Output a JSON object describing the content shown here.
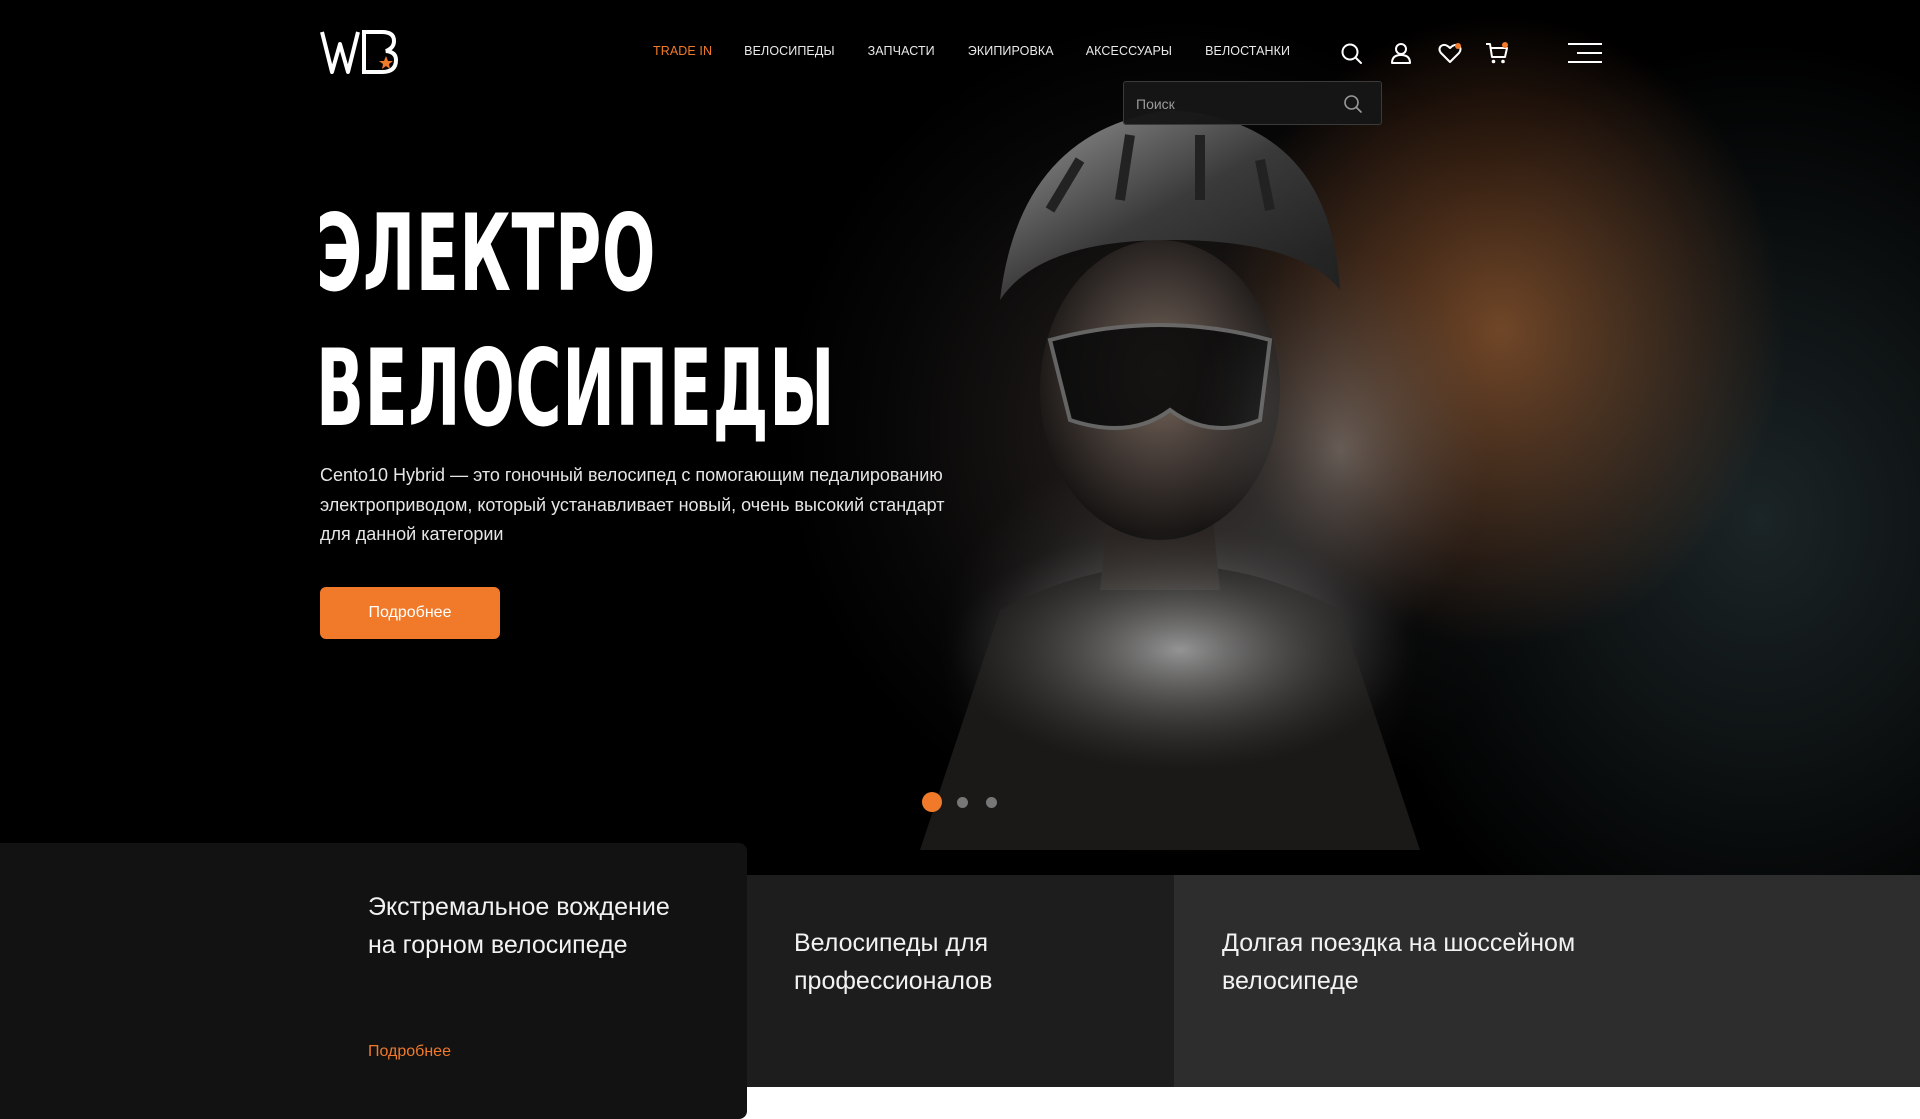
{
  "header": {
    "logo_text": "WB",
    "nav": [
      {
        "label": "TRADE IN"
      },
      {
        "label": "ВЕЛОСИПЕДЫ"
      },
      {
        "label": "ЗАПЧАСТИ"
      },
      {
        "label": "ЭКИПИРОВКА"
      },
      {
        "label": "АКСЕССУАРЫ"
      },
      {
        "label": "ВЕЛОСТАНКИ"
      }
    ],
    "icons": [
      "search-icon",
      "user-icon",
      "heart-icon",
      "cart-icon",
      "menu-icon"
    ],
    "search": {
      "placeholder": "Поиск",
      "value": ""
    }
  },
  "hero": {
    "title_line1": "ЭЛЕКТРО",
    "title_line2": "ВЕЛОСИПЕДЫ",
    "description": "Cento10 Hybrid — это гоночный велосипед с помогающим педалированию электроприводом, который устанавливает новый, очень высокий стандарт для данной категории",
    "cta_label": "Подробнее",
    "slides_total": 3,
    "active_slide": 1
  },
  "cards": [
    {
      "title": "Экстремальное вождение на горном велосипеде",
      "link": "Подробнее"
    },
    {
      "title": "Велосипеды для профессионалов"
    },
    {
      "title": "Долгая поездка на шоссейном велосипеде"
    }
  ],
  "colors": {
    "accent": "#f07a2a",
    "background": "#000000",
    "card1": "#121212",
    "card2": "#1d1d1d",
    "card3": "#2d2d2d"
  }
}
